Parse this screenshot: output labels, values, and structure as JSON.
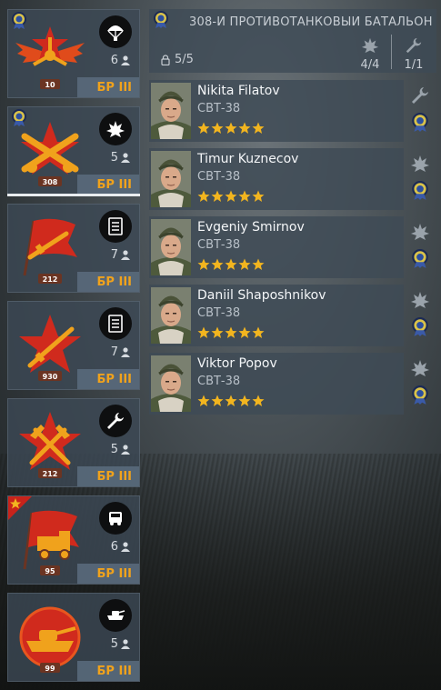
{
  "squads": [
    {
      "count": "6",
      "br": "БР III",
      "emblem_number": "10",
      "class_icon": "parachute-icon",
      "emblem": "winged-star-propeller",
      "has_medal": true
    },
    {
      "count": "5",
      "br": "БР III",
      "emblem_number": "308",
      "class_icon": "explosion-icon",
      "emblem": "crossed-cannons",
      "has_medal": true,
      "selected": true
    },
    {
      "count": "7",
      "br": "БР III",
      "emblem_number": "212",
      "class_icon": "list-icon",
      "emblem": "red-flag-rifle"
    },
    {
      "count": "7",
      "br": "БР III",
      "emblem_number": "930",
      "class_icon": "list-icon",
      "emblem": "red-star-rifle"
    },
    {
      "count": "5",
      "br": "БР III",
      "emblem_number": "212",
      "class_icon": "wrench-icon",
      "emblem": "red-star-hammers"
    },
    {
      "count": "6",
      "br": "БР III",
      "emblem_number": "95",
      "class_icon": "truck-icon",
      "emblem": "flag-truck",
      "has_corner_star": true
    },
    {
      "count": "5",
      "br": "БР III",
      "emblem_number": "99",
      "class_icon": "tank-icon",
      "emblem": "tank-circle"
    }
  ],
  "header": {
    "title": "308-Й ПРОТИВОТАНКОВЫЙ БАТАЛЬОН",
    "members": "5/5",
    "stat_explosive": "4/4",
    "stat_engineer": "1/1"
  },
  "soldiers": [
    {
      "name": "Nikita Filatov",
      "weapon": "СВТ-38",
      "stars": 5,
      "role_icon": "wrench-icon"
    },
    {
      "name": "Timur Kuznecov",
      "weapon": "СВТ-38",
      "stars": 5,
      "role_icon": "explosion-icon"
    },
    {
      "name": "Evgeniy Smirnov",
      "weapon": "СВТ-38",
      "stars": 5,
      "role_icon": "explosion-icon"
    },
    {
      "name": "Daniil Shaposhnikov",
      "weapon": "СВТ-38",
      "stars": 5,
      "role_icon": "explosion-icon"
    },
    {
      "name": "Viktor Popov",
      "weapon": "СВТ-38",
      "stars": 5,
      "role_icon": "explosion-icon"
    }
  ],
  "colors": {
    "br": "#f0a21c",
    "star": "#f2b51f",
    "red": "#c8231b"
  }
}
